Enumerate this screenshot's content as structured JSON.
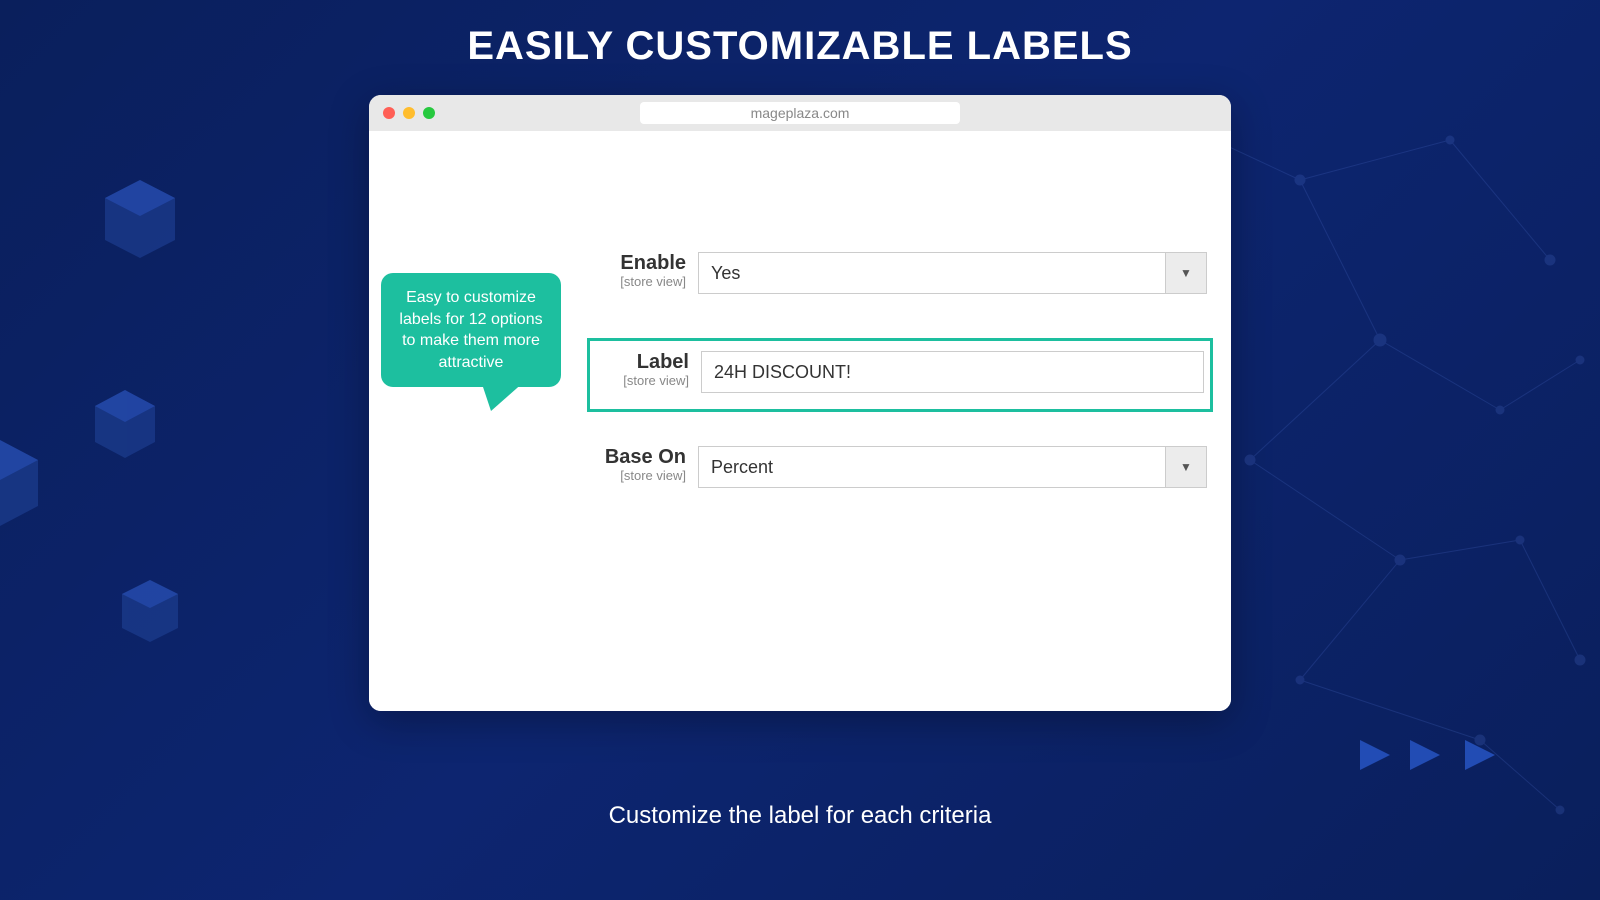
{
  "page": {
    "main_title": "EASILY CUSTOMIZABLE LABELS",
    "subtitle": "Customize the label for each criteria"
  },
  "browser": {
    "url": "mageplaza.com"
  },
  "tooltip": {
    "text": "Easy to customize labels for 12 options to make them more attractive"
  },
  "form": {
    "enable": {
      "label": "Enable",
      "scope": "[store view]",
      "value": "Yes"
    },
    "label_field": {
      "label": "Label",
      "scope": "[store view]",
      "value": "24H DISCOUNT!"
    },
    "base_on": {
      "label": "Base On",
      "scope": "[store view]",
      "value": "Percent"
    }
  }
}
